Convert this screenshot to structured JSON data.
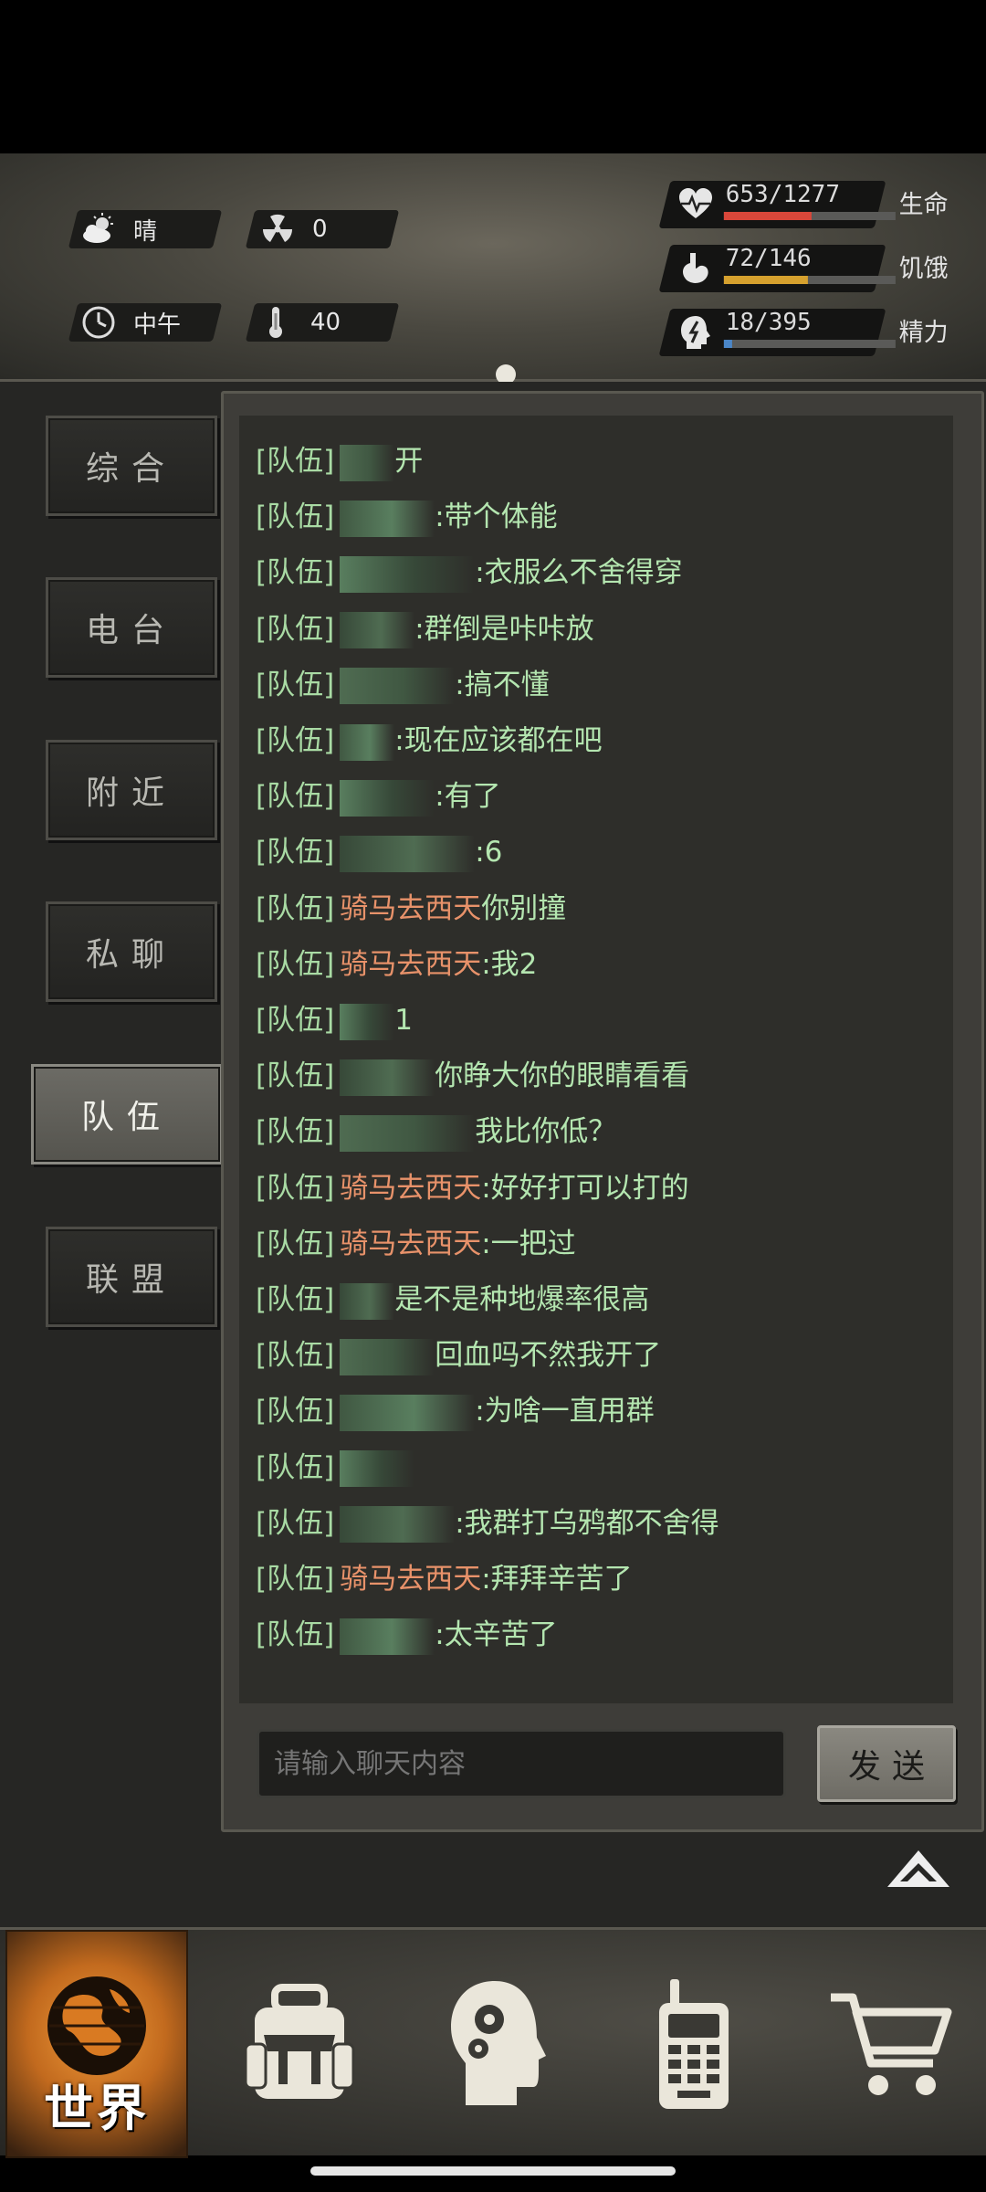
{
  "status": {
    "weather": "晴",
    "radiation": "0",
    "time_of_day": "中午",
    "temperature": "40",
    "health": {
      "text": "653/1277",
      "label": "生命",
      "fraction": 0.51,
      "color": "#d9473a"
    },
    "hunger": {
      "text": "72/146",
      "label": "饥饿",
      "fraction": 0.49,
      "color": "#d6a12e"
    },
    "energy": {
      "text": "18/395",
      "label": "精力",
      "fraction": 0.05,
      "color": "#4a86c8"
    }
  },
  "tabs": [
    "综合",
    "电台",
    "附近",
    "私聊",
    "队伍",
    "联盟"
  ],
  "active_tab": "队伍",
  "channel_tag": "[队伍]",
  "messages": [
    {
      "sender": "",
      "text": "开"
    },
    {
      "sender": "",
      "text": ":带个体能"
    },
    {
      "sender": "",
      "text": ":衣服么不舍得穿"
    },
    {
      "sender": "",
      "text": ":群倒是咔咔放"
    },
    {
      "sender": "",
      "text": ":搞不懂"
    },
    {
      "sender": "",
      "text": ":现在应该都在吧"
    },
    {
      "sender": "",
      "text": ":有了"
    },
    {
      "sender": "",
      "text": ":6"
    },
    {
      "sender": "骑马去西天",
      "text": "你别撞"
    },
    {
      "sender": "骑马去西天",
      "text": ":我2"
    },
    {
      "sender": "",
      "text": "1"
    },
    {
      "sender": "",
      "text": "你睁大你的眼睛看看"
    },
    {
      "sender": "",
      "text": "我比你低？"
    },
    {
      "sender": "骑马去西天",
      "text": ":好好打可以打的"
    },
    {
      "sender": "骑马去西天",
      "text": ":一把过"
    },
    {
      "sender": "",
      "text": "是不是种地爆率很高"
    },
    {
      "sender": "",
      "text": "回血吗不然我开了"
    },
    {
      "sender": "",
      "text": ":为啥一直用群"
    },
    {
      "sender": "",
      "text": ""
    },
    {
      "sender": "",
      "text": ":我群打乌鸦都不舍得"
    },
    {
      "sender": "骑马去西天",
      "text": ":拜拜辛苦了"
    },
    {
      "sender": "",
      "text": ":太辛苦了"
    }
  ],
  "chat_input": {
    "placeholder": "请输入聊天内容",
    "value": ""
  },
  "send_label": "发送",
  "nav": {
    "world_label": "世界"
  }
}
